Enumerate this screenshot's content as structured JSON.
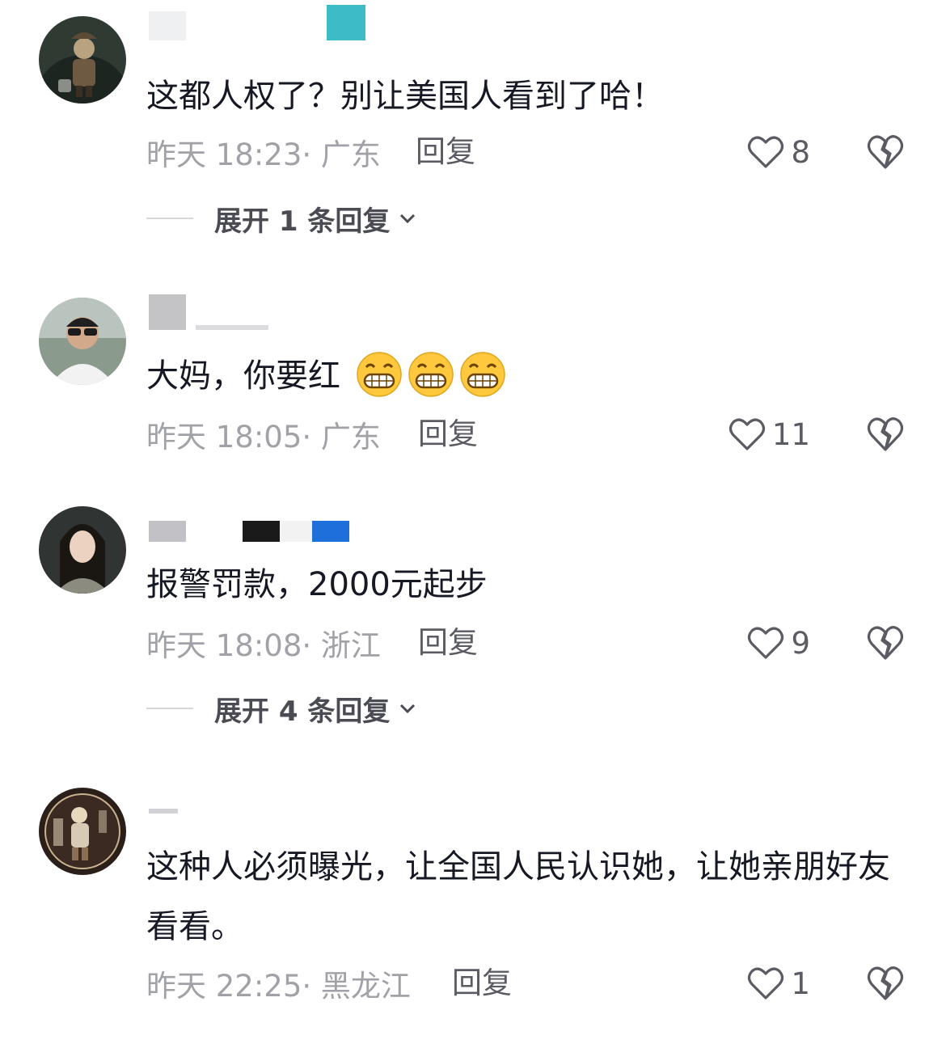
{
  "comments": [
    {
      "text": "这都人权了？别让美国人看到了哈！",
      "meta": "昨天 18:23· 广东",
      "reply_label": "回复",
      "likes": "8",
      "expand_label": "展开 1 条回复"
    },
    {
      "text": "大妈，你要红",
      "emoji": "grinning-face-emoji",
      "meta": "昨天 18:05· 广东",
      "reply_label": "回复",
      "likes": "11"
    },
    {
      "text": "报警罚款，2000元起步",
      "meta": "昨天 18:08· 浙江",
      "reply_label": "回复",
      "likes": "9",
      "expand_label": "展开 4 条回复"
    },
    {
      "text": "这种人必须曝光，让全国人民认识她，让她亲朋好友看看。",
      "meta": "昨天 22:25· 黑龙江",
      "reply_label": "回复",
      "likes": "1"
    }
  ],
  "icons": {
    "like": "heart-outline-icon",
    "dislike": "broken-heart-icon",
    "expand": "chevron-down-icon"
  },
  "colors": {
    "text_primary": "#161823",
    "text_meta": "#a1a2a7",
    "text_reply": "#5a5b63"
  }
}
